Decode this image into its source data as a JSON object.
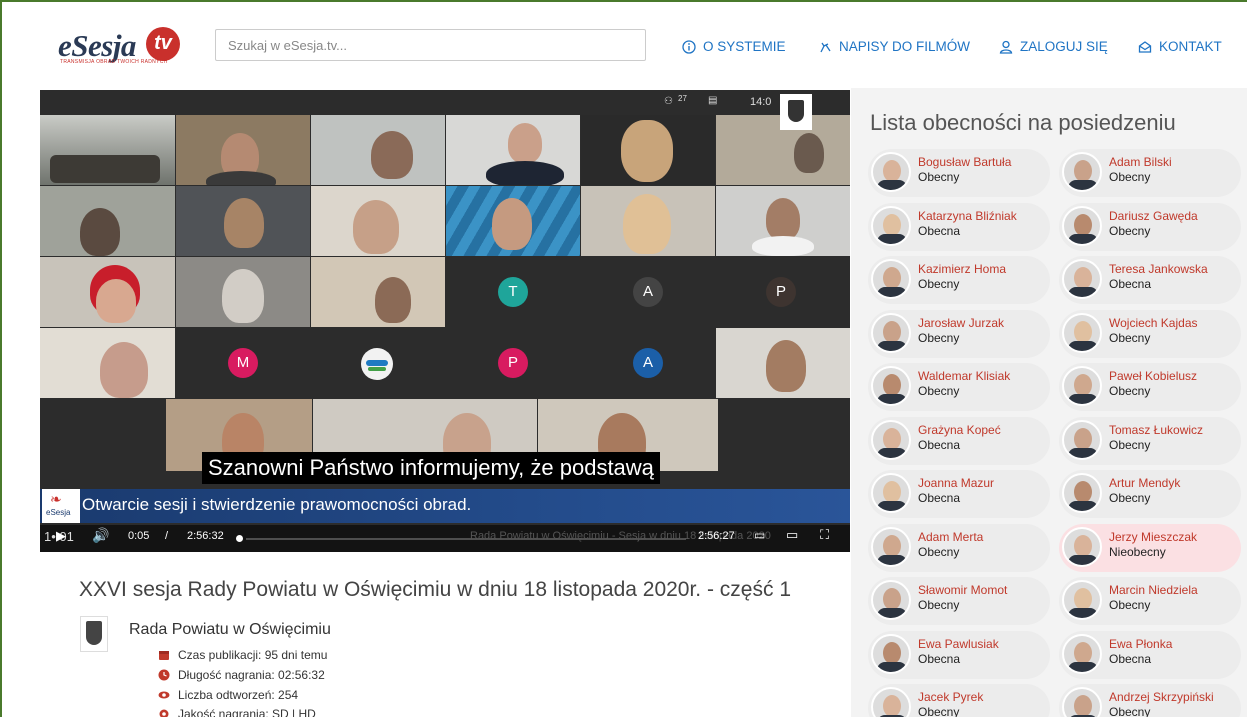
{
  "header": {
    "logo_text": "eSesja",
    "logo_tv": "tv",
    "logo_sub": "TRANSMISJA OBRAD TWOICH RADNYCH",
    "search_placeholder": "Szukaj w eSesja.tv...",
    "nav": [
      {
        "label": "O SYSTEMIE",
        "icon": "info-icon"
      },
      {
        "label": "NAPISY DO FILMÓW",
        "icon": "subtitles-icon"
      },
      {
        "label": "ZALOGUJ SIĘ",
        "icon": "user-icon"
      },
      {
        "label": "KONTAKT",
        "icon": "mail-icon"
      }
    ],
    "accent": "#1f74c4"
  },
  "video": {
    "subtitle": "Szanowni Państwo informujemy, że podstawą",
    "title_bar": "Otwarcie sesji i stwierdzenie prawomocności obrad.",
    "title_logo": "eSesja",
    "corner_count": "27",
    "corner_time": "14:0",
    "controls": {
      "current_time": "0:05",
      "separator": "/",
      "duration": "2:56:32",
      "right_time": "2:56:27",
      "ticker_left": "1• 01",
      "ticker_text": "Rada Powiatu w Oświęcimiu - Sesja w dniu 18 listopada 2020"
    },
    "avatar_letters": [
      "T",
      "A",
      "P",
      "M",
      "P",
      "A"
    ]
  },
  "details": {
    "title": "XXVI sesja Rady Powiatu w Oświęcimiu w dniu 18 listopada 2020r. - część 1",
    "channel": "Rada Powiatu w Oświęcimiu",
    "meta": [
      {
        "label": "Czas publikacji: 95 dni temu",
        "icon": "calendar-icon"
      },
      {
        "label": "Długość nagrania: 02:56:32",
        "icon": "clock-icon"
      },
      {
        "label": "Liczba odtworzeń: 254",
        "icon": "eye-icon"
      },
      {
        "label": "Jakość nagrania: SD | HD",
        "icon": "gear-icon"
      }
    ]
  },
  "sidebar": {
    "title": "Lista obecności na posiedzeniu",
    "attendees": [
      {
        "name": "Bogusław Bartuła",
        "status": "Obecny",
        "absent": false
      },
      {
        "name": "Adam Bilski",
        "status": "Obecny",
        "absent": false
      },
      {
        "name": "Katarzyna Bliźniak",
        "status": "Obecna",
        "absent": false
      },
      {
        "name": "Dariusz Gawęda",
        "status": "Obecny",
        "absent": false
      },
      {
        "name": "Kazimierz Homa",
        "status": "Obecny",
        "absent": false
      },
      {
        "name": "Teresa Jankowska",
        "status": "Obecna",
        "absent": false
      },
      {
        "name": "Jarosław Jurzak",
        "status": "Obecny",
        "absent": false
      },
      {
        "name": "Wojciech Kajdas",
        "status": "Obecny",
        "absent": false
      },
      {
        "name": "Waldemar Klisiak",
        "status": "Obecny",
        "absent": false
      },
      {
        "name": "Paweł Kobielusz",
        "status": "Obecny",
        "absent": false
      },
      {
        "name": "Grażyna Kopeć",
        "status": "Obecna",
        "absent": false
      },
      {
        "name": "Tomasz Łukowicz",
        "status": "Obecny",
        "absent": false
      },
      {
        "name": "Joanna Mazur",
        "status": "Obecna",
        "absent": false
      },
      {
        "name": "Artur Mendyk",
        "status": "Obecny",
        "absent": false
      },
      {
        "name": "Adam Merta",
        "status": "Obecny",
        "absent": false
      },
      {
        "name": "Jerzy Mieszczak",
        "status": "Nieobecny",
        "absent": true
      },
      {
        "name": "Sławomir Momot",
        "status": "Obecny",
        "absent": false
      },
      {
        "name": "Marcin Niedziela",
        "status": "Obecny",
        "absent": false
      },
      {
        "name": "Ewa Pawlusiak",
        "status": "Obecna",
        "absent": false
      },
      {
        "name": "Ewa Płonka",
        "status": "Obecna",
        "absent": false
      },
      {
        "name": "Jacek Pyrek",
        "status": "Obecny",
        "absent": false
      },
      {
        "name": "Andrzej Skrzypiński",
        "status": "Obecny",
        "absent": false
      }
    ]
  }
}
